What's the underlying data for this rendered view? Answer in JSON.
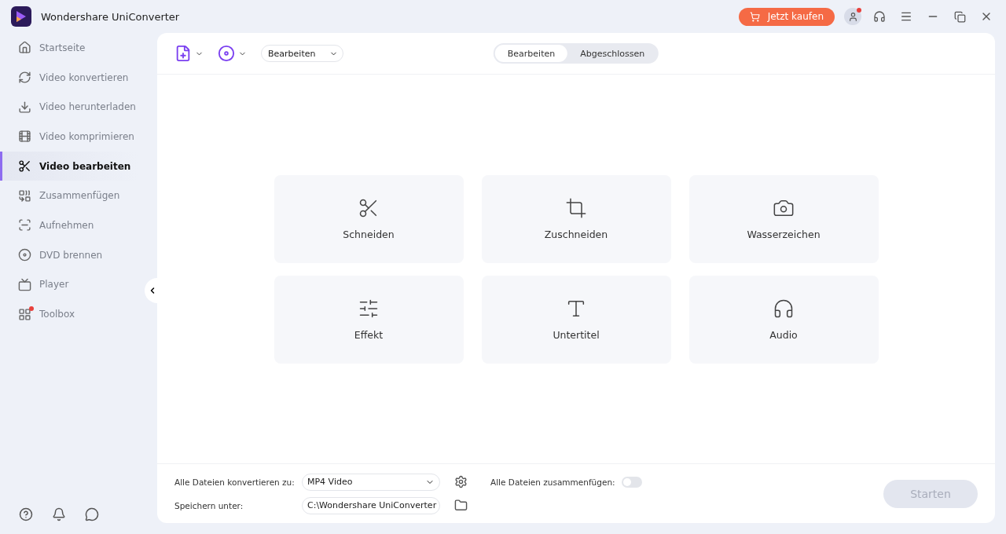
{
  "window": {
    "title": "Wondershare UniConverter"
  },
  "header": {
    "buy_button": "Jetzt kaufen",
    "account_notification": true
  },
  "sidebar": {
    "items": [
      {
        "label": "Startseite",
        "kind": "home",
        "selected": false,
        "notification": false
      },
      {
        "label": "Video konvertieren",
        "kind": "convert",
        "selected": false,
        "notification": false
      },
      {
        "label": "Video herunterladen",
        "kind": "download",
        "selected": false,
        "notification": false
      },
      {
        "label": "Video komprimieren",
        "kind": "compress",
        "selected": false,
        "notification": false
      },
      {
        "label": "Video bearbeiten",
        "kind": "edit",
        "selected": true,
        "notification": false
      },
      {
        "label": "Zusammenfügen",
        "kind": "merge",
        "selected": false,
        "notification": false
      },
      {
        "label": "Aufnehmen",
        "kind": "record",
        "selected": false,
        "notification": false
      },
      {
        "label": "DVD brennen",
        "kind": "dvd",
        "selected": false,
        "notification": false
      },
      {
        "label": "Player",
        "kind": "player",
        "selected": false,
        "notification": false
      },
      {
        "label": "Toolbox",
        "kind": "toolbox",
        "selected": false,
        "notification": true
      }
    ]
  },
  "toolbar": {
    "dropdown": "Bearbeiten",
    "tabs": [
      {
        "label": "Bearbeiten",
        "selected": true
      },
      {
        "label": "Abgeschlossen",
        "selected": false
      }
    ]
  },
  "tools": [
    {
      "label": "Schneiden",
      "kind": "trim"
    },
    {
      "label": "Zuschneiden",
      "kind": "crop"
    },
    {
      "label": "Wasserzeichen",
      "kind": "watermark"
    },
    {
      "label": "Effekt",
      "kind": "effect"
    },
    {
      "label": "Untertitel",
      "kind": "subtitle"
    },
    {
      "label": "Audio",
      "kind": "audio"
    }
  ],
  "footer": {
    "convert_label": "Alle Dateien konvertieren zu:",
    "convert_value": "MP4 Video",
    "save_label": "Speichern unter:",
    "save_value": "C:\\Wondershare UniConverter",
    "merge_label": "Alle Dateien zusammenfügen:",
    "merge_on": false,
    "start_button": "Starten",
    "start_disabled": true
  }
}
